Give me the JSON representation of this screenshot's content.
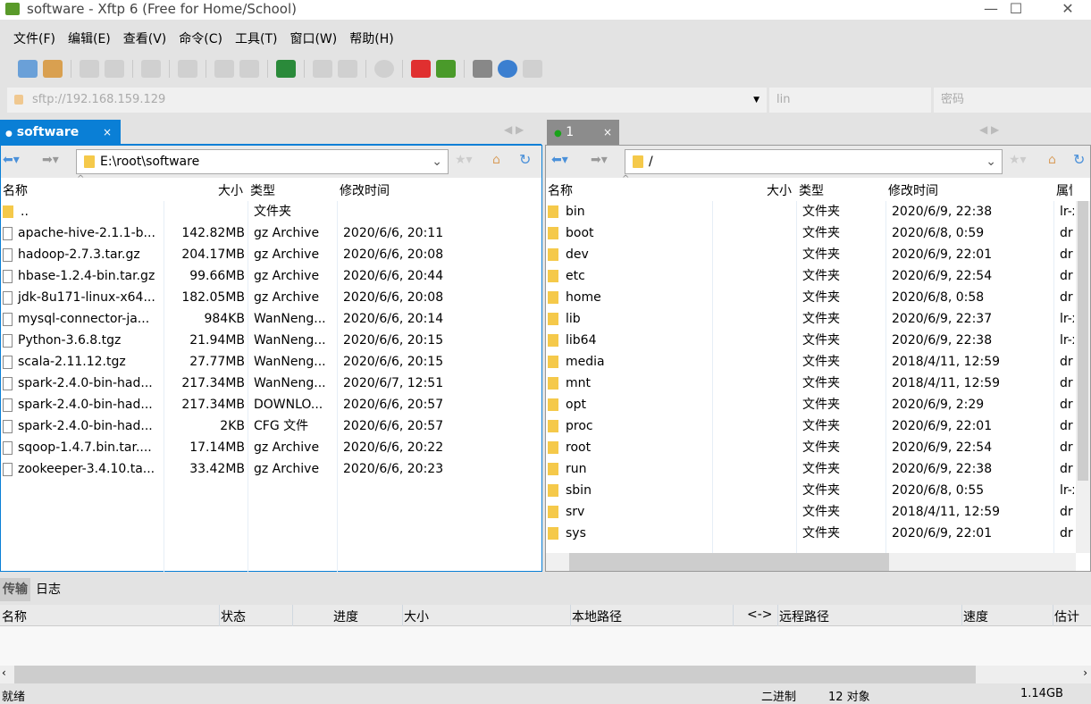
{
  "window": {
    "title": "software - Xftp 6 (Free for Home/School)",
    "min": "—",
    "max": "☐",
    "close": "✕"
  },
  "menu": [
    "文件(F)",
    "编辑(E)",
    "查看(V)",
    "命令(C)",
    "工具(T)",
    "窗口(W)",
    "帮助(H)"
  ],
  "toolbar": [
    "new-session-icon",
    "open-folder-icon",
    "disconnect-icon",
    "reconnect-icon",
    "properties-icon",
    "play-icon",
    "upload-icon",
    "download-icon",
    "transfer-icon",
    "copy-icon",
    "paste-icon",
    "globe-icon",
    "xshell-icon",
    "xftp-icon",
    "settings-icon",
    "help-icon",
    "chat-icon"
  ],
  "address": {
    "url": "sftp://192.168.159.129",
    "user": "lin",
    "password_placeholder": "密码"
  },
  "left": {
    "tab": "software",
    "path": "E:\\root\\software",
    "headers": [
      "名称",
      "大小",
      "类型",
      "修改时间"
    ],
    "rows": [
      [
        "..",
        "",
        "文件夹",
        "",
        "folder"
      ],
      [
        "apache-hive-2.1.1-b...",
        "142.82MB",
        "gz Archive",
        "2020/6/6, 20:11",
        "file"
      ],
      [
        "hadoop-2.7.3.tar.gz",
        "204.17MB",
        "gz Archive",
        "2020/6/6, 20:08",
        "file"
      ],
      [
        "hbase-1.2.4-bin.tar.gz",
        "99.66MB",
        "gz Archive",
        "2020/6/6, 20:44",
        "file"
      ],
      [
        "jdk-8u171-linux-x64...",
        "182.05MB",
        "gz Archive",
        "2020/6/6, 20:08",
        "file"
      ],
      [
        "mysql-connector-ja...",
        "984KB",
        "WanNeng...",
        "2020/6/6, 20:14",
        "file"
      ],
      [
        "Python-3.6.8.tgz",
        "21.94MB",
        "WanNeng...",
        "2020/6/6, 20:15",
        "file"
      ],
      [
        "scala-2.11.12.tgz",
        "27.77MB",
        "WanNeng...",
        "2020/6/6, 20:15",
        "file"
      ],
      [
        "spark-2.4.0-bin-had...",
        "217.34MB",
        "WanNeng...",
        "2020/6/7, 12:51",
        "file"
      ],
      [
        "spark-2.4.0-bin-had...",
        "217.34MB",
        "DOWNLO...",
        "2020/6/6, 20:57",
        "file"
      ],
      [
        "spark-2.4.0-bin-had...",
        "2KB",
        "CFG 文件",
        "2020/6/6, 20:57",
        "file"
      ],
      [
        "sqoop-1.4.7.bin.tar....",
        "17.14MB",
        "gz Archive",
        "2020/6/6, 20:22",
        "file"
      ],
      [
        "zookeeper-3.4.10.ta...",
        "33.42MB",
        "gz Archive",
        "2020/6/6, 20:23",
        "file"
      ]
    ]
  },
  "right": {
    "tab": "1",
    "path": "/",
    "headers": [
      "名称",
      "大小",
      "类型",
      "修改时间",
      "属性"
    ],
    "rows": [
      [
        "bin",
        "",
        "文件夹",
        "2020/6/9, 22:38",
        "lr-x"
      ],
      [
        "boot",
        "",
        "文件夹",
        "2020/6/8, 0:59",
        "dr"
      ],
      [
        "dev",
        "",
        "文件夹",
        "2020/6/9, 22:01",
        "dr"
      ],
      [
        "etc",
        "",
        "文件夹",
        "2020/6/9, 22:54",
        "dr"
      ],
      [
        "home",
        "",
        "文件夹",
        "2020/6/8, 0:58",
        "dr"
      ],
      [
        "lib",
        "",
        "文件夹",
        "2020/6/9, 22:37",
        "lr-x"
      ],
      [
        "lib64",
        "",
        "文件夹",
        "2020/6/9, 22:38",
        "lr-x"
      ],
      [
        "media",
        "",
        "文件夹",
        "2018/4/11, 12:59",
        "dr"
      ],
      [
        "mnt",
        "",
        "文件夹",
        "2018/4/11, 12:59",
        "dr"
      ],
      [
        "opt",
        "",
        "文件夹",
        "2020/6/9, 2:29",
        "dr"
      ],
      [
        "proc",
        "",
        "文件夹",
        "2020/6/9, 22:01",
        "dr"
      ],
      [
        "root",
        "",
        "文件夹",
        "2020/6/9, 22:54",
        "dr"
      ],
      [
        "run",
        "",
        "文件夹",
        "2020/6/9, 22:38",
        "dr"
      ],
      [
        "sbin",
        "",
        "文件夹",
        "2020/6/8, 0:55",
        "lr-x"
      ],
      [
        "srv",
        "",
        "文件夹",
        "2018/4/11, 12:59",
        "dr"
      ],
      [
        "sys",
        "",
        "文件夹",
        "2020/6/9, 22:01",
        "dr"
      ]
    ]
  },
  "bottom": {
    "tabs": [
      "传输",
      "日志"
    ],
    "headers": [
      "名称",
      "状态",
      "进度",
      "大小",
      "本地路径",
      "<->",
      "远程路径",
      "速度",
      "估计剩"
    ]
  },
  "status": {
    "left": "就绪",
    "mode": "二进制",
    "count": "12 对象",
    "size": "1.14GB"
  },
  "colors": {
    "accent": "#0a7fd6",
    "tab_inactive": "#8c8c8c",
    "connected": "#1aa31a"
  }
}
